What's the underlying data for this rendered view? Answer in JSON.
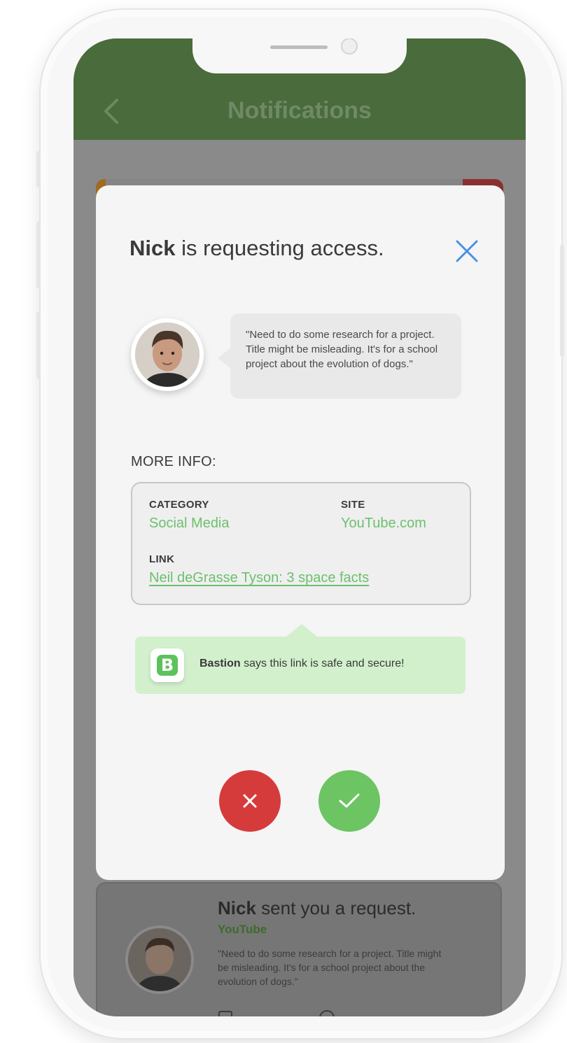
{
  "header": {
    "title": "Notifications"
  },
  "modal": {
    "requester_name": "Nick",
    "title_rest": " is requesting access.",
    "message": "\"Need to do some research for a project. Title might be misleading. It's for a school project about the evolution of dogs.\"",
    "more_info_heading": "MORE INFO:",
    "info": {
      "category_label": "CATEGORY",
      "category_value": "Social Media",
      "site_label": "SITE",
      "site_value": "YouTube.com",
      "link_label": "LINK",
      "link_value": "Neil deGrasse Tyson: 3 space facts"
    },
    "bastion": {
      "brand": "Bastion",
      "message": " says this link is safe and secure!"
    }
  },
  "background_card": {
    "name": "Nick",
    "title_rest": " sent you a request.",
    "site": "YouTube",
    "message": "\"Need to do some research for a project. Title might be misleading. It's for a school project about the evolution of dogs.\""
  },
  "colors": {
    "header": "#4a6b3c",
    "accent_green": "#6cc06c",
    "decline_red": "#d63b3b",
    "accept_green": "#6cc462",
    "close_blue": "#4a90e2"
  }
}
